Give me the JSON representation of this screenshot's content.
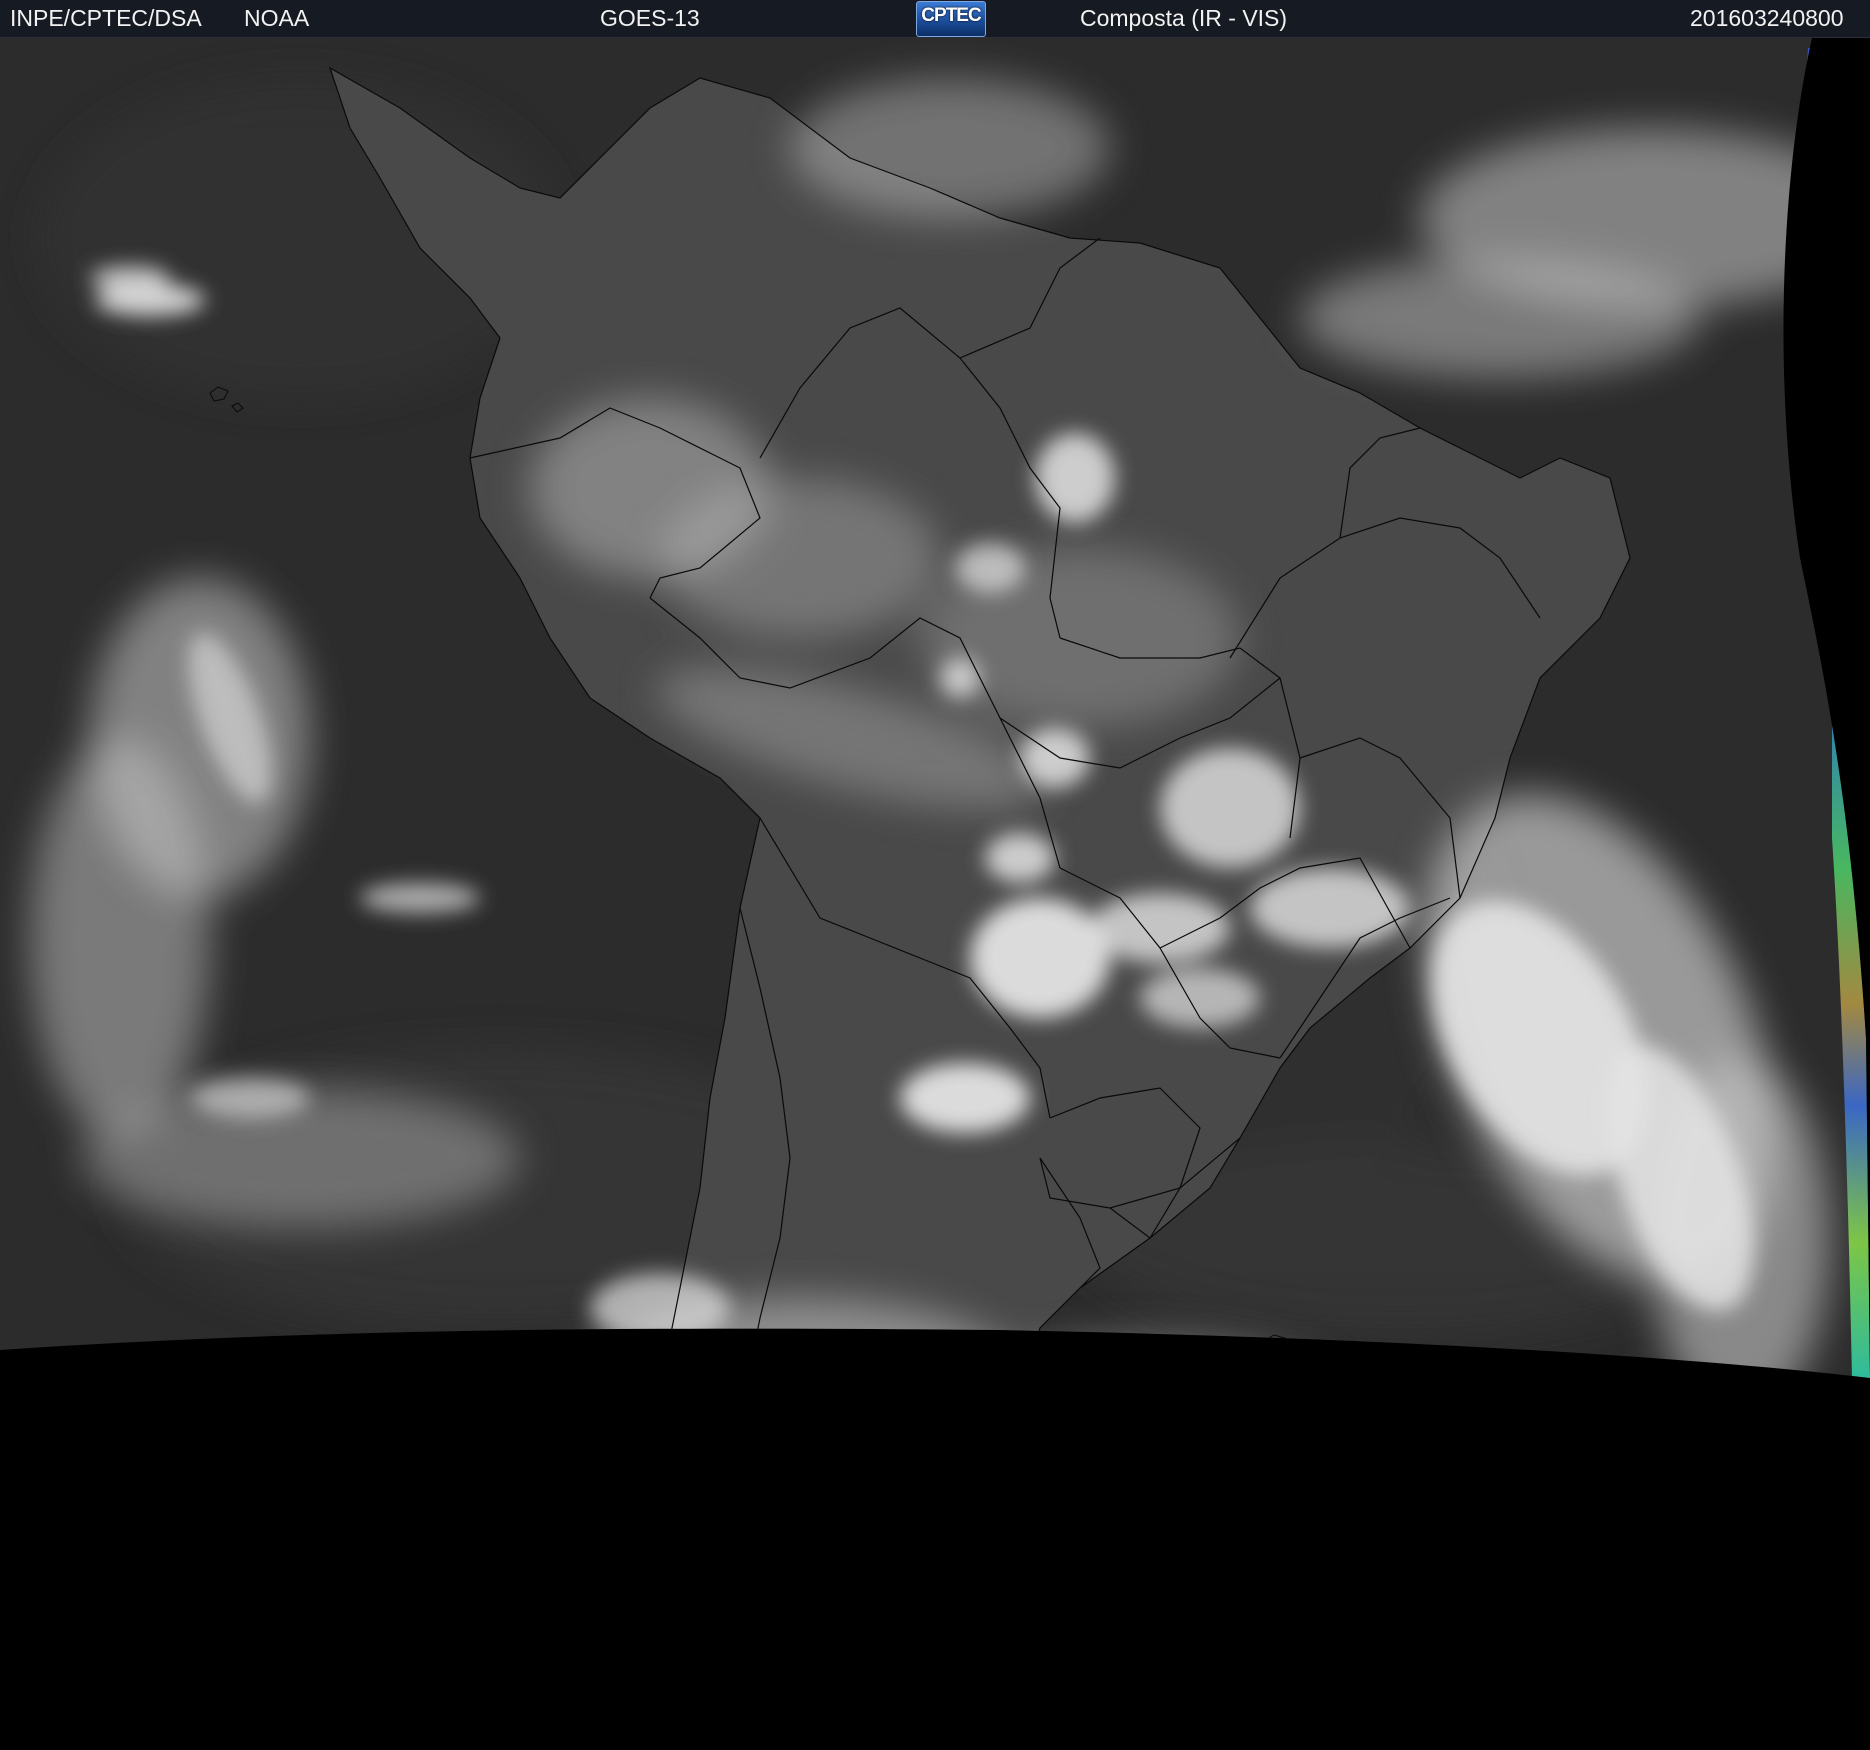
{
  "header": {
    "source": "INPE/CPTEC/DSA",
    "agency": "NOAA",
    "satellite": "GOES-13",
    "logo_text": "CPTEC",
    "product": "Composta (IR - VIS)",
    "datetime": "201603240800"
  },
  "imagery": {
    "subject": "satellite-cloud-image-south-america",
    "colors": {
      "ocean": "#2b2b2b",
      "land": "#4a4a4a",
      "cloud": "#d8d8d8",
      "border_lines": "#000000",
      "space": "#000000",
      "header_bg": "#161a22",
      "edge_false_color": [
        "#2fd66b",
        "#c8a040",
        "#3a6de0",
        "#9be24a"
      ]
    }
  }
}
